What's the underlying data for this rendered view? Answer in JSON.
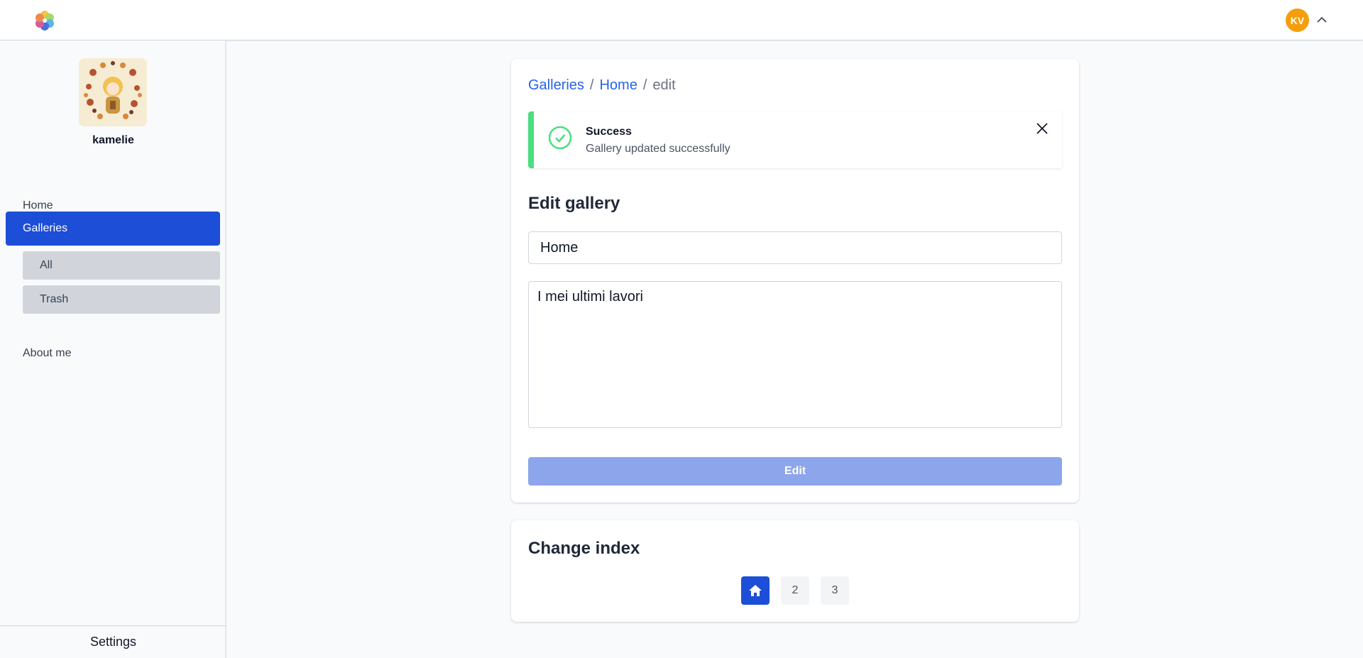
{
  "header": {
    "logo_icon": "pinwheel-logo-icon",
    "user_initials": "KV",
    "avatar_color": "#f59e0b",
    "menu_icon": "chevron-up-icon"
  },
  "sidebar": {
    "username": "kamelie",
    "items": [
      {
        "label": "Home"
      },
      {
        "label": "Galleries",
        "active": true
      },
      {
        "label": "All"
      },
      {
        "label": "Trash"
      },
      {
        "label": "About me"
      }
    ],
    "settings_label": "Settings",
    "accent": "#1d4ed8"
  },
  "breadcrumb": {
    "items": [
      "Galleries",
      "Home",
      "edit"
    ],
    "separator": "/"
  },
  "alert": {
    "title": "Success",
    "message": "Gallery updated successfully",
    "icon": "check-circle-icon",
    "color": "#4ade80"
  },
  "edit_form": {
    "title": "Edit gallery",
    "name_value": "Home",
    "description_value": "I mei ultimi lavori",
    "submit_label": "Edit"
  },
  "index": {
    "title": "Change index",
    "pages": [
      "home-icon",
      "2",
      "3"
    ],
    "current": 1
  }
}
